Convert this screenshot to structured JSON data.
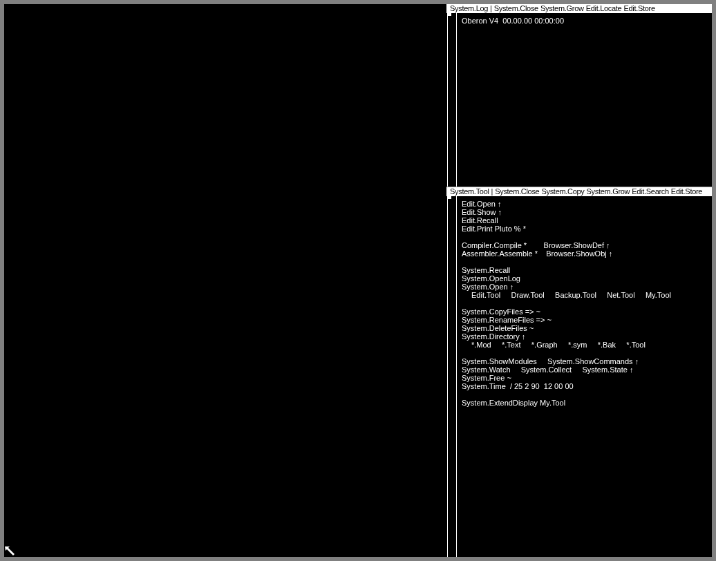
{
  "viewers": [
    {
      "title": {
        "name": "System.Log",
        "separator": "|",
        "commands": [
          "System.Close",
          "System.Grow",
          "Edit.Locate",
          "Edit.Store"
        ]
      },
      "lines": [
        {
          "text": "Oberon V4  00.00.00 00:00:00",
          "indented": false
        }
      ]
    },
    {
      "title": {
        "name": "System.Tool",
        "separator": "|",
        "commands": [
          "System.Close",
          "System.Copy",
          "System.Grow",
          "Edit.Search",
          "Edit.Store"
        ]
      },
      "lines": [
        {
          "text": "Edit.Open ↑",
          "indented": false
        },
        {
          "text": "Edit.Show ↑",
          "indented": false
        },
        {
          "text": "Edit.Recall",
          "indented": false
        },
        {
          "text": "Edit.Print Pluto % *",
          "indented": false
        },
        {
          "kind": "blank"
        },
        {
          "text": "Compiler.Compile *        Browser.ShowDef ↑",
          "indented": false
        },
        {
          "text": "Assembler.Assemble *    Browser.ShowObj ↑",
          "indented": false
        },
        {
          "kind": "blank"
        },
        {
          "text": "System.Recall",
          "indented": false
        },
        {
          "text": "System.OpenLog",
          "indented": false
        },
        {
          "text": "System.Open ↑",
          "indented": false
        },
        {
          "text": "Edit.Tool     Draw.Tool     Backup.Tool     Net.Tool     My.Tool",
          "indented": true
        },
        {
          "kind": "blank"
        },
        {
          "text": "System.CopyFiles => ~",
          "indented": false
        },
        {
          "text": "System.RenameFiles => ~",
          "indented": false
        },
        {
          "text": "System.DeleteFiles ~",
          "indented": false
        },
        {
          "text": "System.Directory ↑",
          "indented": false
        },
        {
          "text": "*.Mod     *.Text     *.Graph     *.sym     *.Bak     *.Tool",
          "indented": true
        },
        {
          "kind": "blank"
        },
        {
          "text": "System.ShowModules     System.ShowCommands ↑",
          "indented": false
        },
        {
          "text": "System.Watch     System.Collect     System.State ↑",
          "indented": false
        },
        {
          "text": "System.Free ~",
          "indented": false
        },
        {
          "text": "System.Time  / 25 2 90  12 00 00",
          "indented": false
        },
        {
          "kind": "blank"
        },
        {
          "text": "System.ExtendDisplay My.Tool",
          "indented": false
        }
      ]
    }
  ]
}
